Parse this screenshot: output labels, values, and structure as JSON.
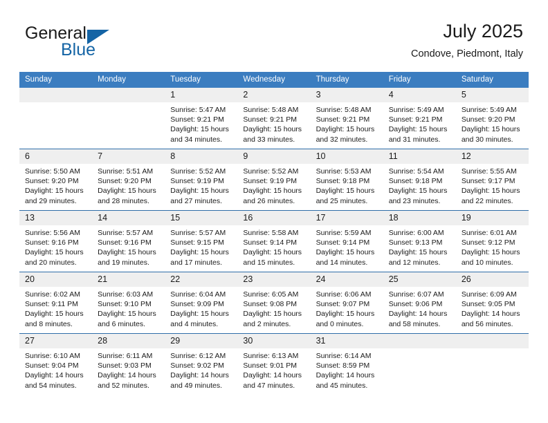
{
  "brand": {
    "name_part1": "General",
    "name_part2": "Blue",
    "accent_color": "#1464a5"
  },
  "header": {
    "title": "July 2025",
    "subtitle": "Condove, Piedmont, Italy"
  },
  "calendar": {
    "header_bg": "#3b7dc0",
    "daynum_bg": "#efefef",
    "row_divider": "#2e6da8",
    "weekday_headers": [
      "Sunday",
      "Monday",
      "Tuesday",
      "Wednesday",
      "Thursday",
      "Friday",
      "Saturday"
    ],
    "weeks": [
      [
        {
          "day": "",
          "sunrise": "",
          "sunset": "",
          "daylight_line1": "",
          "daylight_line2": ""
        },
        {
          "day": "",
          "sunrise": "",
          "sunset": "",
          "daylight_line1": "",
          "daylight_line2": ""
        },
        {
          "day": "1",
          "sunrise": "Sunrise: 5:47 AM",
          "sunset": "Sunset: 9:21 PM",
          "daylight_line1": "Daylight: 15 hours",
          "daylight_line2": "and 34 minutes."
        },
        {
          "day": "2",
          "sunrise": "Sunrise: 5:48 AM",
          "sunset": "Sunset: 9:21 PM",
          "daylight_line1": "Daylight: 15 hours",
          "daylight_line2": "and 33 minutes."
        },
        {
          "day": "3",
          "sunrise": "Sunrise: 5:48 AM",
          "sunset": "Sunset: 9:21 PM",
          "daylight_line1": "Daylight: 15 hours",
          "daylight_line2": "and 32 minutes."
        },
        {
          "day": "4",
          "sunrise": "Sunrise: 5:49 AM",
          "sunset": "Sunset: 9:21 PM",
          "daylight_line1": "Daylight: 15 hours",
          "daylight_line2": "and 31 minutes."
        },
        {
          "day": "5",
          "sunrise": "Sunrise: 5:49 AM",
          "sunset": "Sunset: 9:20 PM",
          "daylight_line1": "Daylight: 15 hours",
          "daylight_line2": "and 30 minutes."
        }
      ],
      [
        {
          "day": "6",
          "sunrise": "Sunrise: 5:50 AM",
          "sunset": "Sunset: 9:20 PM",
          "daylight_line1": "Daylight: 15 hours",
          "daylight_line2": "and 29 minutes."
        },
        {
          "day": "7",
          "sunrise": "Sunrise: 5:51 AM",
          "sunset": "Sunset: 9:20 PM",
          "daylight_line1": "Daylight: 15 hours",
          "daylight_line2": "and 28 minutes."
        },
        {
          "day": "8",
          "sunrise": "Sunrise: 5:52 AM",
          "sunset": "Sunset: 9:19 PM",
          "daylight_line1": "Daylight: 15 hours",
          "daylight_line2": "and 27 minutes."
        },
        {
          "day": "9",
          "sunrise": "Sunrise: 5:52 AM",
          "sunset": "Sunset: 9:19 PM",
          "daylight_line1": "Daylight: 15 hours",
          "daylight_line2": "and 26 minutes."
        },
        {
          "day": "10",
          "sunrise": "Sunrise: 5:53 AM",
          "sunset": "Sunset: 9:18 PM",
          "daylight_line1": "Daylight: 15 hours",
          "daylight_line2": "and 25 minutes."
        },
        {
          "day": "11",
          "sunrise": "Sunrise: 5:54 AM",
          "sunset": "Sunset: 9:18 PM",
          "daylight_line1": "Daylight: 15 hours",
          "daylight_line2": "and 23 minutes."
        },
        {
          "day": "12",
          "sunrise": "Sunrise: 5:55 AM",
          "sunset": "Sunset: 9:17 PM",
          "daylight_line1": "Daylight: 15 hours",
          "daylight_line2": "and 22 minutes."
        }
      ],
      [
        {
          "day": "13",
          "sunrise": "Sunrise: 5:56 AM",
          "sunset": "Sunset: 9:16 PM",
          "daylight_line1": "Daylight: 15 hours",
          "daylight_line2": "and 20 minutes."
        },
        {
          "day": "14",
          "sunrise": "Sunrise: 5:57 AM",
          "sunset": "Sunset: 9:16 PM",
          "daylight_line1": "Daylight: 15 hours",
          "daylight_line2": "and 19 minutes."
        },
        {
          "day": "15",
          "sunrise": "Sunrise: 5:57 AM",
          "sunset": "Sunset: 9:15 PM",
          "daylight_line1": "Daylight: 15 hours",
          "daylight_line2": "and 17 minutes."
        },
        {
          "day": "16",
          "sunrise": "Sunrise: 5:58 AM",
          "sunset": "Sunset: 9:14 PM",
          "daylight_line1": "Daylight: 15 hours",
          "daylight_line2": "and 15 minutes."
        },
        {
          "day": "17",
          "sunrise": "Sunrise: 5:59 AM",
          "sunset": "Sunset: 9:14 PM",
          "daylight_line1": "Daylight: 15 hours",
          "daylight_line2": "and 14 minutes."
        },
        {
          "day": "18",
          "sunrise": "Sunrise: 6:00 AM",
          "sunset": "Sunset: 9:13 PM",
          "daylight_line1": "Daylight: 15 hours",
          "daylight_line2": "and 12 minutes."
        },
        {
          "day": "19",
          "sunrise": "Sunrise: 6:01 AM",
          "sunset": "Sunset: 9:12 PM",
          "daylight_line1": "Daylight: 15 hours",
          "daylight_line2": "and 10 minutes."
        }
      ],
      [
        {
          "day": "20",
          "sunrise": "Sunrise: 6:02 AM",
          "sunset": "Sunset: 9:11 PM",
          "daylight_line1": "Daylight: 15 hours",
          "daylight_line2": "and 8 minutes."
        },
        {
          "day": "21",
          "sunrise": "Sunrise: 6:03 AM",
          "sunset": "Sunset: 9:10 PM",
          "daylight_line1": "Daylight: 15 hours",
          "daylight_line2": "and 6 minutes."
        },
        {
          "day": "22",
          "sunrise": "Sunrise: 6:04 AM",
          "sunset": "Sunset: 9:09 PM",
          "daylight_line1": "Daylight: 15 hours",
          "daylight_line2": "and 4 minutes."
        },
        {
          "day": "23",
          "sunrise": "Sunrise: 6:05 AM",
          "sunset": "Sunset: 9:08 PM",
          "daylight_line1": "Daylight: 15 hours",
          "daylight_line2": "and 2 minutes."
        },
        {
          "day": "24",
          "sunrise": "Sunrise: 6:06 AM",
          "sunset": "Sunset: 9:07 PM",
          "daylight_line1": "Daylight: 15 hours",
          "daylight_line2": "and 0 minutes."
        },
        {
          "day": "25",
          "sunrise": "Sunrise: 6:07 AM",
          "sunset": "Sunset: 9:06 PM",
          "daylight_line1": "Daylight: 14 hours",
          "daylight_line2": "and 58 minutes."
        },
        {
          "day": "26",
          "sunrise": "Sunrise: 6:09 AM",
          "sunset": "Sunset: 9:05 PM",
          "daylight_line1": "Daylight: 14 hours",
          "daylight_line2": "and 56 minutes."
        }
      ],
      [
        {
          "day": "27",
          "sunrise": "Sunrise: 6:10 AM",
          "sunset": "Sunset: 9:04 PM",
          "daylight_line1": "Daylight: 14 hours",
          "daylight_line2": "and 54 minutes."
        },
        {
          "day": "28",
          "sunrise": "Sunrise: 6:11 AM",
          "sunset": "Sunset: 9:03 PM",
          "daylight_line1": "Daylight: 14 hours",
          "daylight_line2": "and 52 minutes."
        },
        {
          "day": "29",
          "sunrise": "Sunrise: 6:12 AM",
          "sunset": "Sunset: 9:02 PM",
          "daylight_line1": "Daylight: 14 hours",
          "daylight_line2": "and 49 minutes."
        },
        {
          "day": "30",
          "sunrise": "Sunrise: 6:13 AM",
          "sunset": "Sunset: 9:01 PM",
          "daylight_line1": "Daylight: 14 hours",
          "daylight_line2": "and 47 minutes."
        },
        {
          "day": "31",
          "sunrise": "Sunrise: 6:14 AM",
          "sunset": "Sunset: 8:59 PM",
          "daylight_line1": "Daylight: 14 hours",
          "daylight_line2": "and 45 minutes."
        },
        {
          "day": "",
          "sunrise": "",
          "sunset": "",
          "daylight_line1": "",
          "daylight_line2": ""
        },
        {
          "day": "",
          "sunrise": "",
          "sunset": "",
          "daylight_line1": "",
          "daylight_line2": ""
        }
      ]
    ]
  }
}
